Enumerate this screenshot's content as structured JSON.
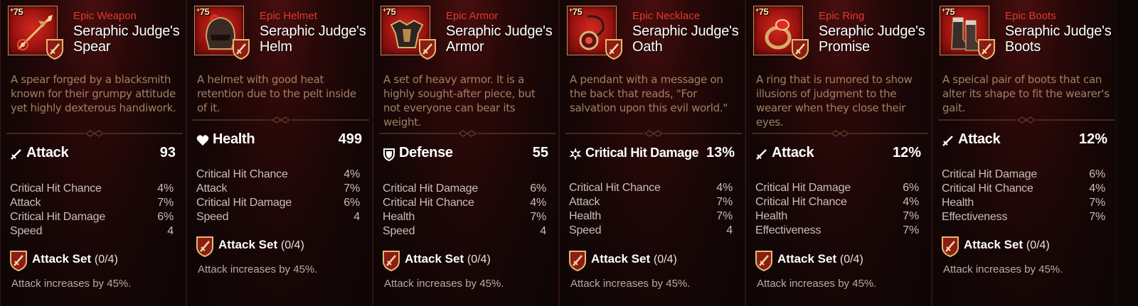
{
  "colors": {
    "rarity_epic": "#e23a2a",
    "description": "#a08062",
    "frame_gold": "#c58f5c",
    "icon_bg": "#b21c14"
  },
  "cards": [
    {
      "level": "75",
      "rarity": "Epic Weapon",
      "name": "Seraphic Judge's Spear",
      "item_icon": "spear-icon",
      "description": "A spear forged by a blacksmith known for their grumpy attitude yet highly dexterous handiwork.",
      "main_stat": {
        "icon": "sword-icon",
        "label": "Attack",
        "value": "93"
      },
      "substats": [
        {
          "label": "Critical Hit Chance",
          "value": "4%"
        },
        {
          "label": "Attack",
          "value": "7%"
        },
        {
          "label": "Critical Hit Damage",
          "value": "6%"
        },
        {
          "label": "Speed",
          "value": "4"
        }
      ],
      "set": {
        "label": "Attack Set",
        "count": "(0/4)",
        "effect": "Attack increases by 45%."
      }
    },
    {
      "level": "75",
      "rarity": "Epic Helmet",
      "name": "Seraphic Judge's Helm",
      "item_icon": "helmet-icon",
      "description": "A helmet with good heat retention due to the pelt inside of it.",
      "main_stat": {
        "icon": "heart-icon",
        "label": "Health",
        "value": "499"
      },
      "substats": [
        {
          "label": "Critical Hit Chance",
          "value": "4%"
        },
        {
          "label": "Attack",
          "value": "7%"
        },
        {
          "label": "Critical Hit Damage",
          "value": "6%"
        },
        {
          "label": "Speed",
          "value": "4"
        }
      ],
      "set": {
        "label": "Attack Set",
        "count": "(0/4)",
        "effect": "Attack increases by 45%."
      }
    },
    {
      "level": "75",
      "rarity": "Epic Armor",
      "name": "Seraphic Judge's Armor",
      "item_icon": "armor-icon",
      "description": "A set of heavy armor. It is a highly sought-after piece, but not everyone can bear its weight.",
      "main_stat": {
        "icon": "shield-icon",
        "label": "Defense",
        "value": "55"
      },
      "substats": [
        {
          "label": "Critical Hit Damage",
          "value": "6%"
        },
        {
          "label": "Critical Hit Chance",
          "value": "4%"
        },
        {
          "label": "Health",
          "value": "7%"
        },
        {
          "label": "Speed",
          "value": "4"
        }
      ],
      "set": {
        "label": "Attack Set",
        "count": "(0/4)",
        "effect": "Attack increases by 45%."
      }
    },
    {
      "level": "75",
      "rarity": "Epic Necklace",
      "name": "Seraphic Judge's Oath",
      "item_icon": "necklace-icon",
      "description": "A pendant with a message on the back that reads, \"For salvation upon this evil world.\"",
      "main_stat": {
        "icon": "burst-icon",
        "label": "Critical Hit Damage",
        "value": "13%"
      },
      "substats": [
        {
          "label": "Critical Hit Chance",
          "value": "4%"
        },
        {
          "label": "Attack",
          "value": "7%"
        },
        {
          "label": "Health",
          "value": "7%"
        },
        {
          "label": "Speed",
          "value": "4"
        }
      ],
      "set": {
        "label": "Attack Set",
        "count": "(0/4)",
        "effect": "Attack increases by 45%."
      }
    },
    {
      "level": "75",
      "rarity": "Epic Ring",
      "name": "Seraphic Judge's Promise",
      "item_icon": "ring-icon",
      "description": "A ring that is rumored to show illusions of judgment to the wearer when they close their eyes.",
      "main_stat": {
        "icon": "sword-icon",
        "label": "Attack",
        "value": "12%"
      },
      "substats": [
        {
          "label": "Critical Hit Damage",
          "value": "6%"
        },
        {
          "label": "Critical Hit Chance",
          "value": "4%"
        },
        {
          "label": "Health",
          "value": "7%"
        },
        {
          "label": "Effectiveness",
          "value": "7%"
        }
      ],
      "set": {
        "label": "Attack Set",
        "count": "(0/4)",
        "effect": "Attack increases by 45%."
      }
    },
    {
      "level": "75",
      "rarity": "Epic Boots",
      "name": "Seraphic Judge's Boots",
      "item_icon": "boots-icon",
      "description": "A speical pair of boots that can alter its shape to fit the wearer's gait.",
      "main_stat": {
        "icon": "sword-icon",
        "label": "Attack",
        "value": "12%"
      },
      "substats": [
        {
          "label": "Critical Hit Damage",
          "value": "6%"
        },
        {
          "label": "Critical Hit Chance",
          "value": "4%"
        },
        {
          "label": "Health",
          "value": "7%"
        },
        {
          "label": "Effectiveness",
          "value": "7%"
        }
      ],
      "set": {
        "label": "Attack Set",
        "count": "(0/4)",
        "effect": "Attack increases by 45%."
      }
    }
  ]
}
